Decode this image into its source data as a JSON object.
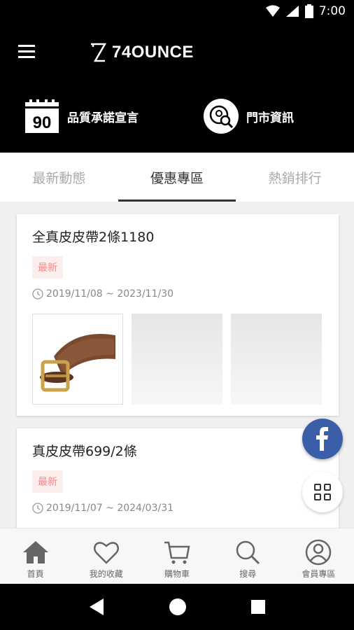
{
  "status": {
    "time": "7:00"
  },
  "header": {
    "logo_text": "74OUNCE",
    "quality_label": "品質承諾宣言",
    "quality_number": "90",
    "store_label": "門市資訊"
  },
  "tabs": [
    {
      "label": "最新動態",
      "active": false
    },
    {
      "label": "優惠專區",
      "active": true
    },
    {
      "label": "熱銷排行",
      "active": false
    }
  ],
  "promos": [
    {
      "title": "全真皮皮帶2條1180",
      "badge": "最新",
      "date_range": "2019/11/08 ~ 2023/11/30"
    },
    {
      "title": "真皮皮帶699/2條",
      "badge": "最新",
      "date_range": "2019/11/07 ~ 2024/03/31"
    }
  ],
  "bottom_nav": [
    {
      "label": "首頁",
      "icon": "home-icon",
      "active": true
    },
    {
      "label": "我的收藏",
      "icon": "heart-icon",
      "active": false
    },
    {
      "label": "購物車",
      "icon": "cart-icon",
      "active": false
    },
    {
      "label": "搜尋",
      "icon": "search-icon",
      "active": false
    },
    {
      "label": "會員專區",
      "icon": "user-icon",
      "active": false
    }
  ],
  "colors": {
    "accent": "#000000",
    "badge_bg": "#fdeeee",
    "badge_text": "#f28a8a",
    "facebook": "#3b5ea9"
  }
}
